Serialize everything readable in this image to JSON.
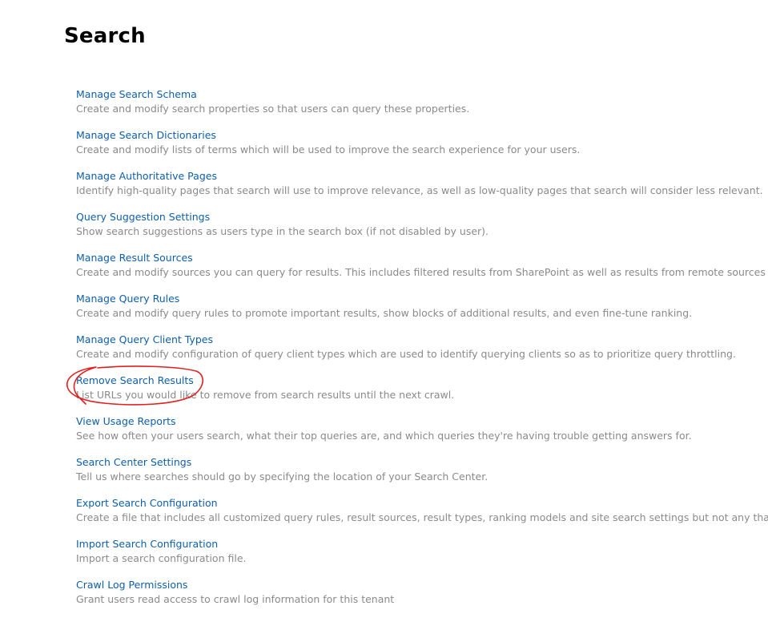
{
  "page": {
    "title": "Search"
  },
  "settings": [
    {
      "label": "Manage Search Schema",
      "description": "Create and modify search properties so that users can query these properties."
    },
    {
      "label": "Manage Search Dictionaries",
      "description": "Create and modify lists of terms which will be used to improve the search experience for your users."
    },
    {
      "label": "Manage Authoritative Pages",
      "description": "Identify high-quality pages that search will use to improve relevance, as well as low-quality pages that search will consider less relevant."
    },
    {
      "label": "Query Suggestion Settings",
      "description": "Show search suggestions as users type in the search box (if not disabled by user)."
    },
    {
      "label": "Manage Result Sources",
      "description": "Create and modify sources you can query for results. This includes filtered results from SharePoint as well as results from remote sources s"
    },
    {
      "label": "Manage Query Rules",
      "description": "Create and modify query rules to promote important results, show blocks of additional results, and even fine-tune ranking."
    },
    {
      "label": "Manage Query Client Types",
      "description": "Create and modify configuration of query client types which are used to identify querying clients so as to prioritize query throttling."
    },
    {
      "label": "Remove Search Results",
      "description": "List URLs you would like to remove from search results until the next crawl."
    },
    {
      "label": "View Usage Reports",
      "description": "See how often your users search, what their top queries are, and which queries they're having trouble getting answers for."
    },
    {
      "label": "Search Center Settings",
      "description": "Tell us where searches should go by specifying the location of your Search Center."
    },
    {
      "label": "Export Search Configuration",
      "description": "Create a file that includes all customized query rules, result sources, result types, ranking models and site search settings but not any that"
    },
    {
      "label": "Import Search Configuration",
      "description": "Import a search configuration file."
    },
    {
      "label": "Crawl Log Permissions",
      "description": "Grant users read access to crawl log information for this tenant"
    }
  ],
  "colors": {
    "link": "#0f5fa8",
    "description": "#8a8a8a",
    "annotation": "#e02020"
  }
}
